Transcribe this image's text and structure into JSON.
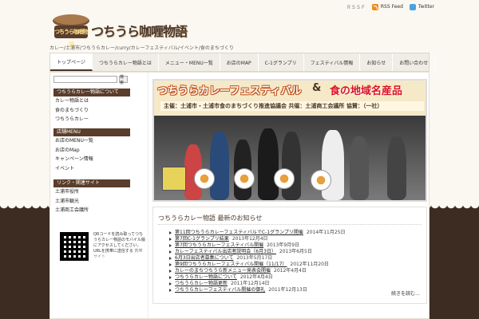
{
  "topbar": {
    "link_gray": "ＲＳＳＦ",
    "rss_label": "RSS Feed",
    "twitter_label": "Twitter"
  },
  "logo": {
    "blimp_text": "つちうら咖喱物語",
    "title": "つちうら咖喱物語"
  },
  "tagline": "カレー/土浦市/つちうらカレー/curry/カレーフェスティバル/イベント/食のまちづくり",
  "nav": {
    "items": [
      "トップページ",
      "つちうらカレー物語とは",
      "メニュー・MENU一覧",
      "お店のMAP",
      "C-1グランプリ",
      "フェスティバル情報",
      "お知らせ",
      "お問い合わせ"
    ]
  },
  "search": {
    "placeholder": "",
    "button_label": "検索"
  },
  "sidebar": {
    "sections": [
      {
        "heading": "つちうらカレー物語について",
        "items": [
          "カレー物語とは",
          "食のまちづくり",
          "つちうらカレー"
        ]
      },
      {
        "heading": "店舗MENU",
        "items": [
          "お店のMENU一覧",
          "お店のMap",
          "キャンペーン情報",
          "イベント"
        ]
      },
      {
        "heading": "リンク・関連サイト",
        "items": [
          "土浦市役所",
          "土浦市観光",
          "土浦商工会議所"
        ]
      }
    ],
    "qr_text": "QRコードを読み取ってつちうらカレー物語のモバイル版にアクセスしてください。URLを携帯に送信する",
    "qr_text_gray": "携帯サイト"
  },
  "hero": {
    "title_left": "つちうらカレーフェスティバル",
    "amp": "&",
    "title_right": "食の地域名産品",
    "sub": "主催：土浦市・土浦市食のまちづくり推進協議会 共催：土浦商工会議所 協賛：（一社）"
  },
  "news": {
    "title": "つちうらカレー物語 最新のお知らせ",
    "items": [
      {
        "t": "第11回つちうらカレーフェスティバルでC-1グランプリ開催",
        "d": "2014年11月25日"
      },
      {
        "t": "第7回C-1グランプリ結果",
        "d": "2013年12月4日"
      },
      {
        "t": "第7回つちうらカレーフェスティバル開催",
        "d": "2013年9月9日"
      },
      {
        "t": "カレーフェスティバル出店者説明会（6月3日）",
        "d": "2013年6月5日"
      },
      {
        "t": "6月3日出店者募集について",
        "d": "2013年5月17日"
      },
      {
        "t": "第9回つちうらカレーフェスティバル開催（11/17）",
        "d": "2012年11月20日"
      },
      {
        "t": "カレーのまちつちうら新メニュー発表会開催",
        "d": "2012年4月4日"
      },
      {
        "t": "つちうらカレー物語について",
        "d": "2012年4月4日"
      },
      {
        "t": "つちうらカレー物語更新",
        "d": "2011年12月14日"
      },
      {
        "t": "つちうらカレーフェスティバル開催の御礼",
        "d": "2011年12月13日"
      }
    ],
    "more": "続きを読む…"
  }
}
